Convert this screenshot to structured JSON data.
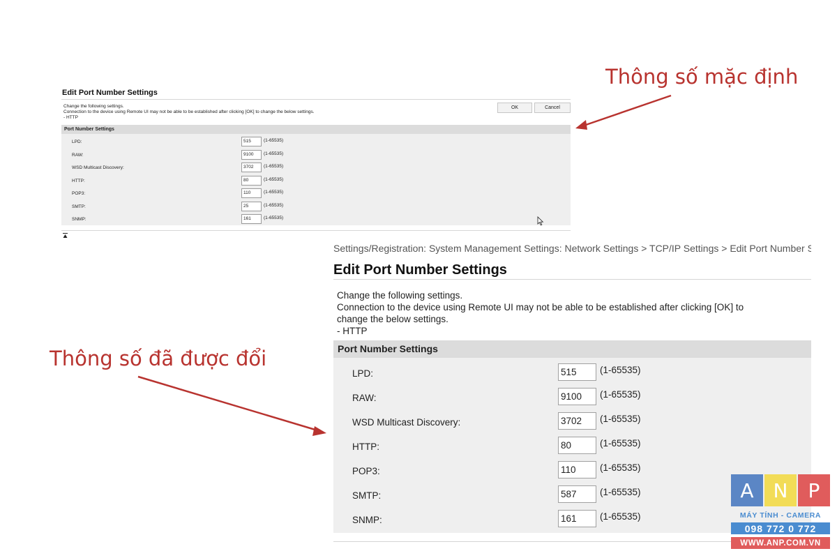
{
  "default_panel": {
    "title": "Edit Port Number Settings",
    "description": [
      "Change the following settings.",
      "Connection to the device using Remote UI may not be able to be established after clicking [OK] to change the below settings.",
      "- HTTP"
    ],
    "ok_label": "OK",
    "cancel_label": "Cancel",
    "section_title": "Port Number Settings",
    "rows": [
      {
        "label": "LPD:",
        "value": "515",
        "range": "(1-65535)"
      },
      {
        "label": "RAW:",
        "value": "9100",
        "range": "(1-65535)"
      },
      {
        "label": "WSD Multicast Discovery:",
        "value": "3702",
        "range": "(1-65535)"
      },
      {
        "label": "HTTP:",
        "value": "80",
        "range": "(1-65535)"
      },
      {
        "label": "POP3:",
        "value": "110",
        "range": "(1-65535)"
      },
      {
        "label": "SMTP:",
        "value": "25",
        "range": "(1-65535)"
      },
      {
        "label": "SNMP:",
        "value": "161",
        "range": "(1-65535)"
      }
    ],
    "back_to_top_icon": "back-to-top-icon"
  },
  "changed_panel": {
    "breadcrumb": "Settings/Registration: System Management Settings: Network Settings > TCP/IP Settings > Edit Port Number Settings",
    "title": "Edit Port Number Settings",
    "description": [
      "Change the following settings.",
      "Connection to the device using Remote UI may not be able to be established after clicking [OK] to",
      "change the below settings.",
      "- HTTP"
    ],
    "section_title": "Port Number Settings",
    "rows": [
      {
        "label": "LPD:",
        "value": "515",
        "range": "(1-65535)"
      },
      {
        "label": "RAW:",
        "value": "9100",
        "range": "(1-65535)"
      },
      {
        "label": "WSD Multicast Discovery:",
        "value": "3702",
        "range": "(1-65535)"
      },
      {
        "label": "HTTP:",
        "value": "80",
        "range": "(1-65535)"
      },
      {
        "label": "POP3:",
        "value": "110",
        "range": "(1-65535)"
      },
      {
        "label": "SMTP:",
        "value": "587",
        "range": "(1-65535)"
      },
      {
        "label": "SNMP:",
        "value": "161",
        "range": "(1-65535)"
      }
    ]
  },
  "annotations": {
    "default_note": "Thông số mặc định",
    "changed_note": "Thông số đã được đổi",
    "color": "#b8332f"
  },
  "logo": {
    "letters": [
      "A",
      "N",
      "P"
    ],
    "tagline": "MÁY TÍNH - CAMERA",
    "phone": "098 772 0 772",
    "website": "WWW.ANP.COM.VN",
    "colors": {
      "a": "#5b86c5",
      "n": "#f2dc57",
      "p": "#e05c5c",
      "blue": "#4a8cd0"
    }
  }
}
